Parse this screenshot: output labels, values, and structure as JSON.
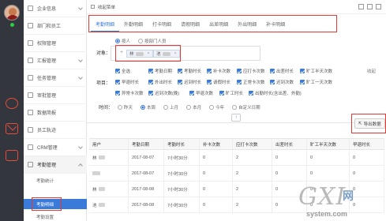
{
  "breadcrumb": "收起菜单",
  "sidebar": {
    "items": [
      {
        "label": "企业信息"
      },
      {
        "label": "部门和员工"
      },
      {
        "label": "权限管理"
      },
      {
        "label": "汇报管理"
      },
      {
        "label": "任务管理"
      },
      {
        "label": "审批管理"
      },
      {
        "label": "数据简报"
      },
      {
        "label": "员工轨迹"
      },
      {
        "label": "CRM管理"
      },
      {
        "label": "考勤管理"
      }
    ],
    "sub_items": [
      {
        "label": "考勤统计"
      },
      {
        "label": "考勤明细"
      },
      {
        "label": "考勤设置"
      }
    ]
  },
  "tabs": [
    {
      "label": "考勤明细"
    },
    {
      "label": "外勤明细"
    },
    {
      "label": "打卡明细"
    },
    {
      "label": "请假明细"
    },
    {
      "label": "出差明细"
    },
    {
      "label": "外出明细"
    },
    {
      "label": "补卡明细"
    }
  ],
  "filter": {
    "radio_options": [
      "按人",
      "按部门人员"
    ],
    "object_label": "对象：",
    "object_tags": [
      {
        "label": "林"
      },
      {
        "label": "池"
      }
    ],
    "items_label": "项目：",
    "collapse_label": "收起",
    "checkboxes": [
      "全选",
      "考勤日期",
      "考勤时长",
      "补卡次数",
      "应打卡次数",
      "出差时长",
      "旷工半天次数",
      "早退时长",
      "外出时长",
      "迟到时长",
      "请假时长",
      "正常卡次数",
      "迟到次数",
      "旷工一天次数",
      "异常卡次数",
      "迟到次数(晚)",
      "早退次数",
      "旷工时长",
      "出勤时长(含出差、外勤)"
    ],
    "time_label": "时间：",
    "time_options": [
      "昨天",
      "本周",
      "上月",
      "本月",
      "今年",
      "自定义日期"
    ]
  },
  "export_label": "导出数据",
  "table": {
    "columns": [
      "用户",
      "考勤日期",
      "考勤时长",
      "补卡次数",
      "应打卡次数",
      "出差时长",
      "旷工半天次数",
      "早退时长"
    ],
    "rows": [
      {
        "user": "林",
        "date": "2017-08-07",
        "duration": "7小时30分",
        "makeup": "0",
        "expected": "2",
        "trip": "0",
        "absent": "0",
        "early": "0"
      },
      {
        "user": "",
        "date": "2017-08-07",
        "duration": "7小时30分",
        "makeup": "0",
        "expected": "2",
        "trip": "0",
        "absent": "0",
        "early": "0"
      },
      {
        "user": "林",
        "date": "2017-08-08",
        "duration": "7小时30分",
        "makeup": "0",
        "expected": "2",
        "trip": "0",
        "absent": "0",
        "early": "0"
      },
      {
        "user": "池",
        "date": "2017-08-08",
        "duration": "7小时30分",
        "makeup": "0",
        "expected": "2",
        "trip": "0",
        "absent": "0",
        "early": "0"
      }
    ]
  },
  "watermark": {
    "main": "GXI",
    "net": "网",
    "sub": "system.com"
  }
}
